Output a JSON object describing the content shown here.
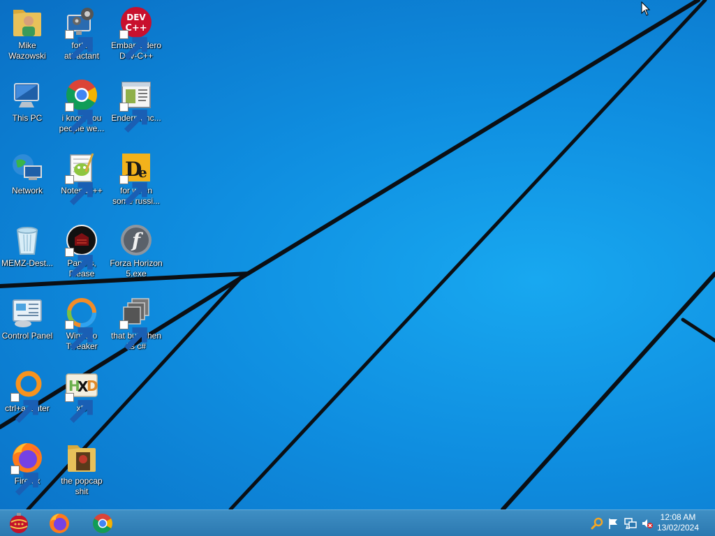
{
  "desktop": {
    "icons": [
      {
        "label": "Mike Wazowski",
        "icon": "user-folder-icon",
        "shortcut": false
      },
      {
        "label": "forkie attractant",
        "icon": "gears-monitor-icon",
        "shortcut": true
      },
      {
        "label": "Embarcadero Dev-C++",
        "icon": "devcpp-icon",
        "shortcut": true
      },
      {
        "label": "This PC",
        "icon": "computer-icon",
        "shortcut": false
      },
      {
        "label": "i know you people we...",
        "icon": "chrome-icon",
        "shortcut": true
      },
      {
        "label": "Endermanc...",
        "icon": "window-document-icon",
        "shortcut": true
      },
      {
        "label": "Network",
        "icon": "network-globe-icon",
        "shortcut": false
      },
      {
        "label": "Notepad++",
        "icon": "notepad-plus-plus-icon",
        "shortcut": true
      },
      {
        "label": "for when some russi...",
        "icon": "de-icon",
        "shortcut": true
      },
      {
        "label": "MEMZ-Dest...",
        "icon": "recycle-bin-icon",
        "shortcut": false
      },
      {
        "label": "Papers, Please",
        "icon": "papers-please-icon",
        "shortcut": true
      },
      {
        "label": "Forza Horizon 5.exe",
        "icon": "flash-icon",
        "shortcut": false
      },
      {
        "label": "Control Panel",
        "icon": "control-panel-icon",
        "shortcut": false
      },
      {
        "label": "Winaero Tweaker",
        "icon": "winaero-icon",
        "shortcut": true
      },
      {
        "label": "that but when its c#",
        "icon": "stacked-windows-icon",
        "shortcut": true
      },
      {
        "label": "ctrl+a, enter",
        "icon": "orange-ring-icon",
        "shortcut": true
      },
      {
        "label": "xD",
        "icon": "hxd-icon",
        "shortcut": true
      },
      {
        "label": "Firefox",
        "icon": "firefox-icon",
        "shortcut": true
      },
      {
        "label": "the popcap shit",
        "icon": "popcap-folder-icon",
        "shortcut": false
      }
    ]
  },
  "taskbar": {
    "start_icon": "ornament-start-icon",
    "pinned": [
      {
        "icon": "firefox-icon"
      },
      {
        "icon": "chrome-icon"
      }
    ],
    "tray": [
      {
        "icon": "search-tray-icon"
      },
      {
        "icon": "flag-tray-icon"
      },
      {
        "icon": "network-tray-icon"
      },
      {
        "icon": "volume-muted-tray-icon"
      }
    ],
    "clock": {
      "time": "12:08 AM",
      "date": "13/02/2024"
    }
  },
  "colors": {
    "wallpaper": "#0f8ee0",
    "taskbar": "#3584bb",
    "line": "#0b0f14"
  }
}
